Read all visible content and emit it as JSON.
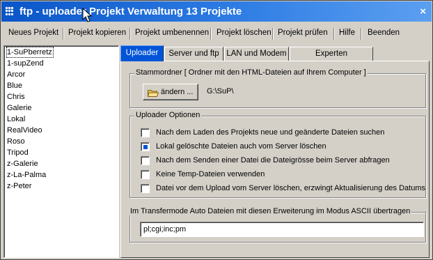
{
  "window": {
    "title": "ftp - uploader Projekt Verwaltung 13 Projekte",
    "close_symbol": "×",
    "icons": {
      "app": "app-grid-icon",
      "close": "close-icon",
      "cursor": "mouse-pointer-icon"
    }
  },
  "menu": {
    "items": [
      {
        "label": "Neues Projekt"
      },
      {
        "label": "Projekt kopieren"
      },
      {
        "label": "Projekt umbenennen"
      },
      {
        "label": "Projekt löschen"
      },
      {
        "label": "Projekt prüfen"
      },
      {
        "label": "Hilfe"
      },
      {
        "label": "Beenden"
      }
    ]
  },
  "projects": {
    "selected_index": 0,
    "items": [
      "1-SuPberretz",
      "1-supZend",
      "Arcor",
      "Blue",
      "Chris",
      "Galerie",
      "Lokal",
      "RealVideo",
      "Roso",
      "Tripod",
      "z-Galerie",
      "z-La-Palma",
      "z-Peter"
    ]
  },
  "tabs": {
    "active_index": 0,
    "items": [
      {
        "label": "Uploader"
      },
      {
        "label": "Server und ftp"
      },
      {
        "label": "LAN und Modem"
      },
      {
        "label": "Experten Einstellungen"
      }
    ]
  },
  "stammordner": {
    "legend": "Stammordner  [ Ordner mit den HTML-Dateien auf Ihrem Computer ]",
    "change_button": "ändern ...",
    "change_icon": "folder-open-icon",
    "path": "G:\\SuP\\"
  },
  "options": {
    "legend": "Uploader Optionen",
    "items": [
      {
        "label": "Nach dem Laden des Projekts neue und geänderte Dateien suchen",
        "checked": false
      },
      {
        "label": "Lokal gelöschte Dateien auch vom Server löschen",
        "checked": true
      },
      {
        "label": "Nach dem Senden einer Datei die Dateigrösse beim Server abfragen",
        "checked": false
      },
      {
        "label": "Keine Temp-Dateien verwenden",
        "checked": false
      },
      {
        "label": "Datei vor dem Upload vom Server löschen, erzwingt Aktualisierung des Datums",
        "checked": false
      }
    ]
  },
  "ascii": {
    "legend": "Im Transfermode Auto Dateien mit diesen Erweiterung im Modus ASCII übertragen",
    "value": "pl;cgi;inc;pm"
  },
  "colors": {
    "titlebar": "#0a55c8",
    "active_tab": "#0054d8",
    "face": "#d4d0c8"
  }
}
